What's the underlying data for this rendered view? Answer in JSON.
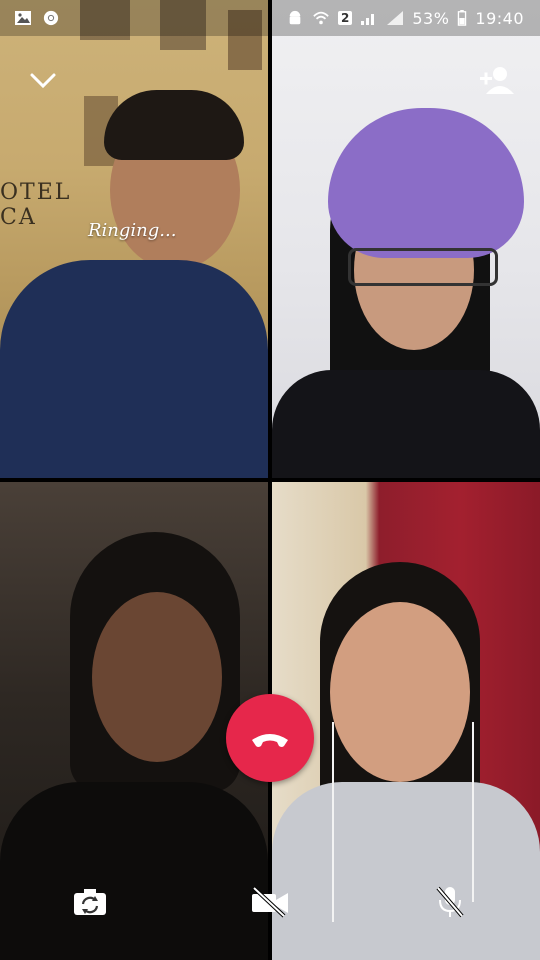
{
  "status_bar": {
    "badge": "2",
    "battery": "53%",
    "time": "19:40"
  },
  "call": {
    "status": "Ringing...",
    "sign_text": "OTEL CA"
  },
  "icons": {
    "collapse": "chevron-down-icon",
    "add_participant": "add-person-icon",
    "end_call": "phone-hangup-icon",
    "switch_camera": "camera-switch-icon",
    "video_off": "video-off-icon",
    "mute": "mic-off-icon"
  },
  "colors": {
    "end_call": "#e6274b"
  }
}
